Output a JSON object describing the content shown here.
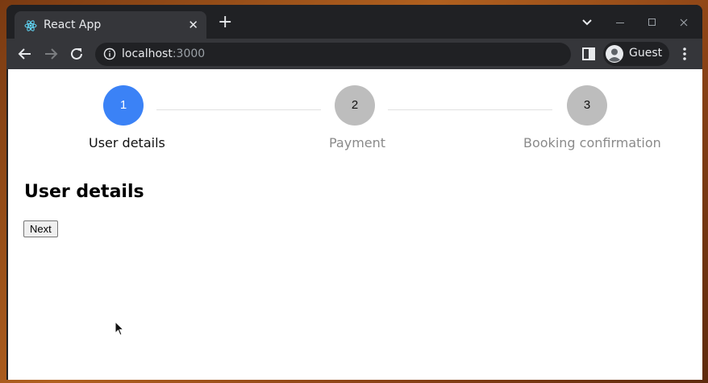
{
  "browser": {
    "tab": {
      "title": "React App",
      "favicon": "react-logo-icon",
      "close_icon": "close-icon"
    },
    "new_tab_icon": "plus-icon",
    "window_controls": {
      "tab_search": "chevron-down-icon",
      "minimize": "minimize-icon",
      "maximize": "maximize-icon",
      "close": "close-icon"
    },
    "toolbar": {
      "back_icon": "back-arrow-icon",
      "forward_icon": "forward-arrow-icon",
      "reload_icon": "reload-icon",
      "url_host": "localhost",
      "url_port": ":3000",
      "site_info_icon": "info-icon",
      "side_panel_icon": "side-panel-icon",
      "profile_name": "Guest",
      "menu_icon": "kebab-menu-icon"
    }
  },
  "page": {
    "steps": [
      {
        "number": "1",
        "label": "User details",
        "state": "active"
      },
      {
        "number": "2",
        "label": "Payment",
        "state": "inactive"
      },
      {
        "number": "3",
        "label": "Booking confirmation",
        "state": "inactive"
      }
    ],
    "heading": "User details",
    "next_button": "Next"
  },
  "colors": {
    "active_step": "#3b82f6",
    "inactive_step": "#bdbdbd",
    "browser_frame": "#202124",
    "toolbar": "#35363a"
  }
}
